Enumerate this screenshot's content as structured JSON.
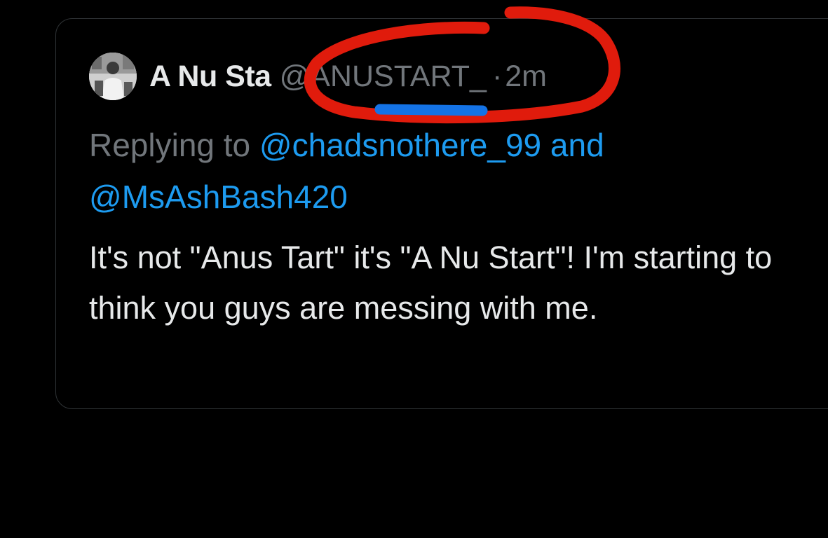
{
  "tweet": {
    "display_name": "A Nu Sta",
    "handle": "@ANUSTART_",
    "separator": "·",
    "time": "2m",
    "replying_prefix": "Replying to ",
    "mention_1": "@chadsnothere_99",
    "conjunction": " and",
    "mention_2": "@MsAshBash420",
    "text": "It's not \"Anus Tart\" it's \"A Nu Start\"! I'm starting to think you guys are messing with me."
  },
  "colors": {
    "background": "#000000",
    "name_text": "#e7e9ea",
    "muted_text": "#71767b",
    "mention_blue": "#1d9bf0",
    "annotation_red": "#e01b0c",
    "annotation_blue": "#1473e6"
  },
  "icons": {
    "avatar": "profile-photo"
  }
}
